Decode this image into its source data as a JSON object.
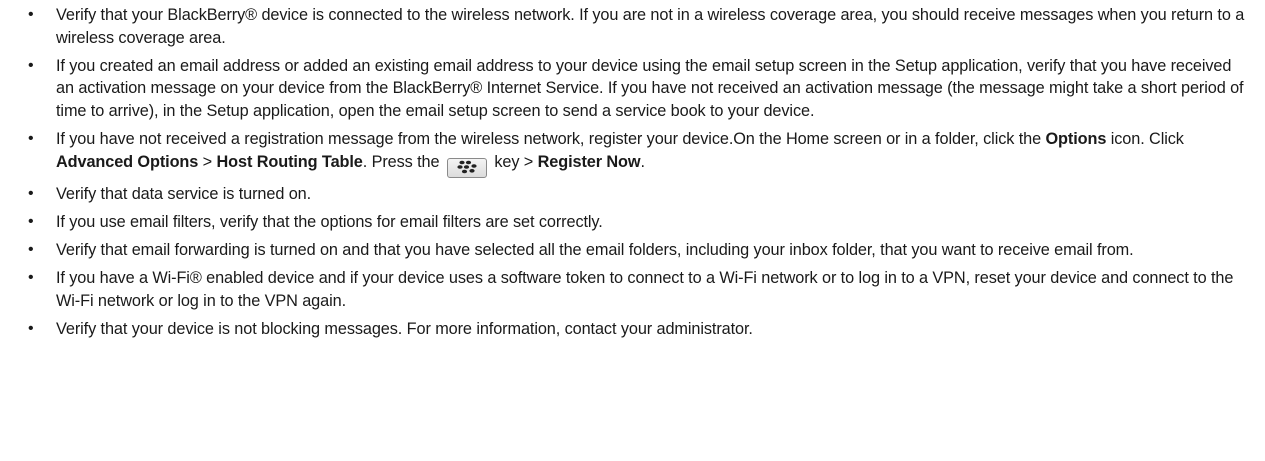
{
  "items": [
    {
      "text": "Verify that your BlackBerry® device is connected to the wireless network. If you are not in a wireless coverage area, you should receive messages when you return to a wireless coverage area."
    },
    {
      "text": "If you created an email address or added an existing email address to your device using the email setup screen in the Setup application, verify that you have received an activation message on your device from the BlackBerry® Internet Service. If you have not received an activation message (the message might take a short period of time to arrive), in the Setup application, open the email setup screen to send a service book to your device."
    },
    {
      "part1": "If you have not received a registration message from the wireless network, register your device.On the Home screen or in a folder, click the ",
      "options": "Options",
      "part2": " icon. Click ",
      "advanced": "Advanced Options",
      "sep1": " > ",
      "host": "Host Routing Table",
      "part3": ". Press the ",
      "key_icon": "blackberry-menu-key-icon",
      "part4": " key > ",
      "register": "Register Now",
      "part5": "."
    },
    {
      "text": "Verify that data service is turned on."
    },
    {
      "text": "If you use email filters, verify that the options for email filters are set correctly."
    },
    {
      "text": "Verify that email forwarding is turned on and that you have selected all the email folders, including your inbox folder, that you want to receive email from."
    },
    {
      "text": "If you have a Wi-Fi® enabled device and if your device uses a software token to connect to a Wi-Fi network or to log in to a VPN, reset your device and connect to the Wi-Fi network or log in to the VPN again."
    },
    {
      "text": "Verify that your device is not blocking messages. For more information, contact your administrator."
    }
  ],
  "bullet": "•"
}
